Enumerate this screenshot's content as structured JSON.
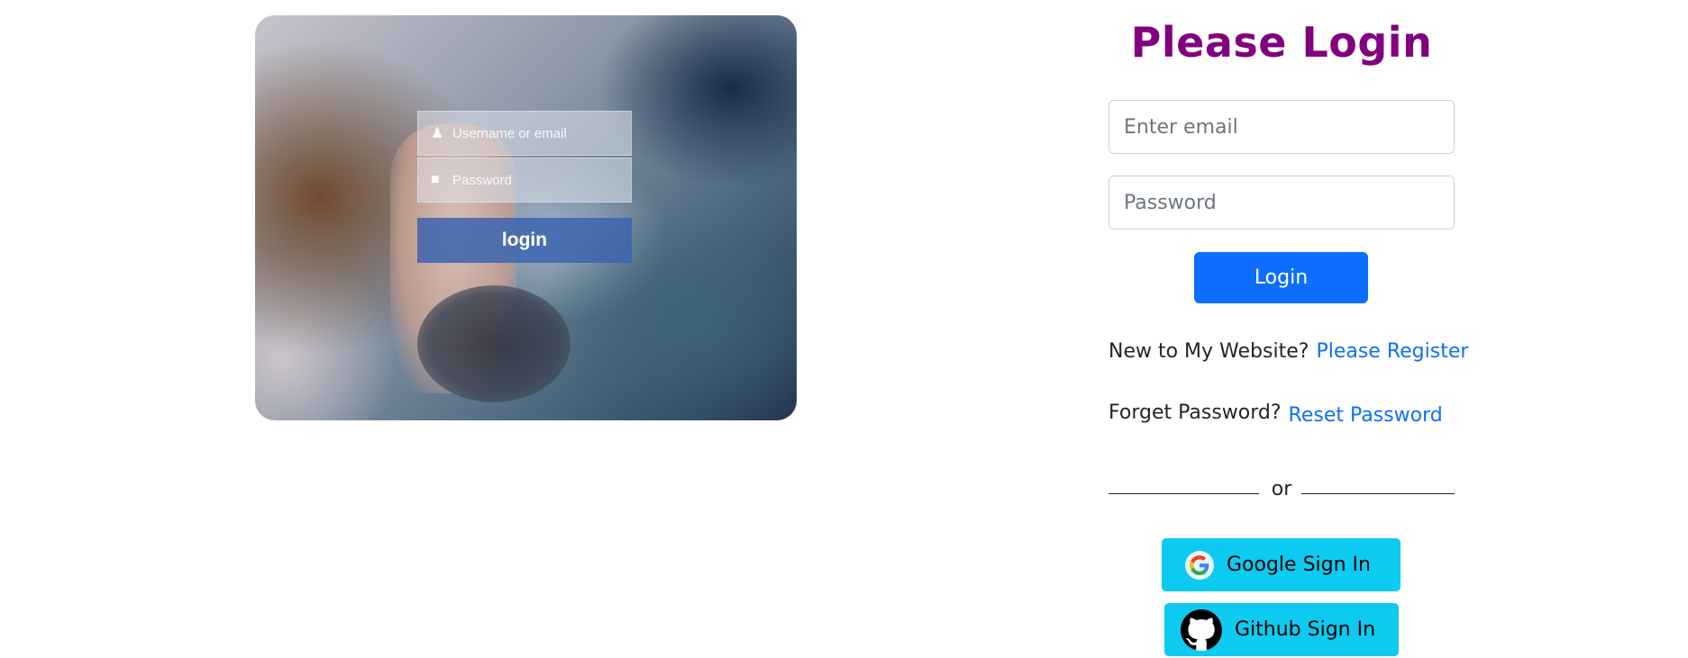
{
  "hero": {
    "mock_username": "Username or email",
    "mock_password": "Password",
    "mock_login": "login"
  },
  "login": {
    "title": "Please Login",
    "email_placeholder": "Enter email",
    "password_placeholder": "Password",
    "login_button": "Login",
    "register_prompt": "New to My Website?",
    "register_link": "Please Register",
    "forgot_prompt": "Forget Password?",
    "reset_link": "Reset Password",
    "divider_text": "or",
    "google_button": "Google Sign In",
    "github_button": "Github Sign In"
  },
  "colors": {
    "title": "#800080",
    "primary": "#0d6efd",
    "social": "#0dcaf0",
    "link": "#0d6efd"
  },
  "icons": {
    "google": "google-icon",
    "github": "github-icon"
  }
}
